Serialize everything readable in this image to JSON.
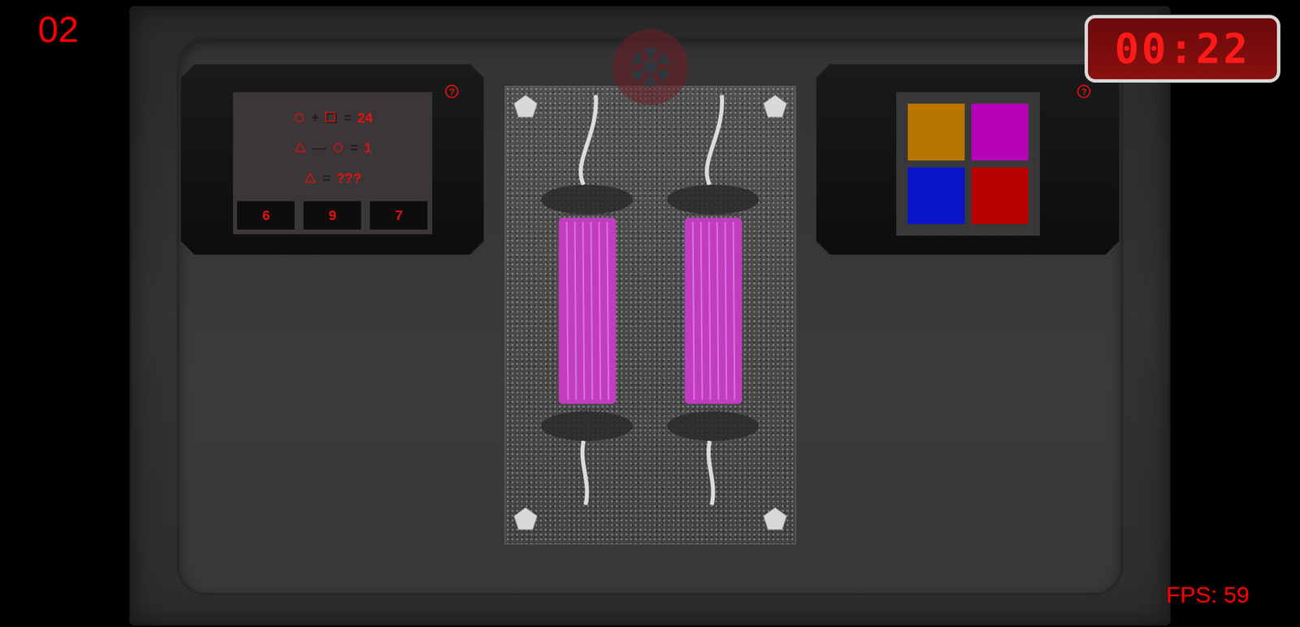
{
  "level_counter": "02",
  "timer": "00:22",
  "fps": "FPS: 59",
  "math_module": {
    "help": "?",
    "equations": [
      {
        "tokens": [
          {
            "kind": "circle"
          },
          {
            "kind": "operator",
            "text": "+"
          },
          {
            "kind": "square"
          },
          {
            "kind": "operator",
            "text": "="
          },
          {
            "kind": "value",
            "text": "24"
          }
        ]
      },
      {
        "tokens": [
          {
            "kind": "triangle"
          },
          {
            "kind": "operator",
            "text": "—"
          },
          {
            "kind": "circle"
          },
          {
            "kind": "operator",
            "text": "="
          },
          {
            "kind": "value",
            "text": "1"
          }
        ]
      },
      {
        "tokens": [
          {
            "kind": "triangle"
          },
          {
            "kind": "operator",
            "text": "="
          },
          {
            "kind": "value",
            "text": "???"
          }
        ]
      }
    ],
    "answers": [
      {
        "label": "6"
      },
      {
        "label": "9"
      },
      {
        "label": "7"
      }
    ]
  },
  "color_module": {
    "help": "?",
    "squares": [
      {
        "color": "#b87500"
      },
      {
        "color": "#b800b8"
      },
      {
        "color": "#0a14c8"
      },
      {
        "color": "#b80000"
      }
    ]
  }
}
